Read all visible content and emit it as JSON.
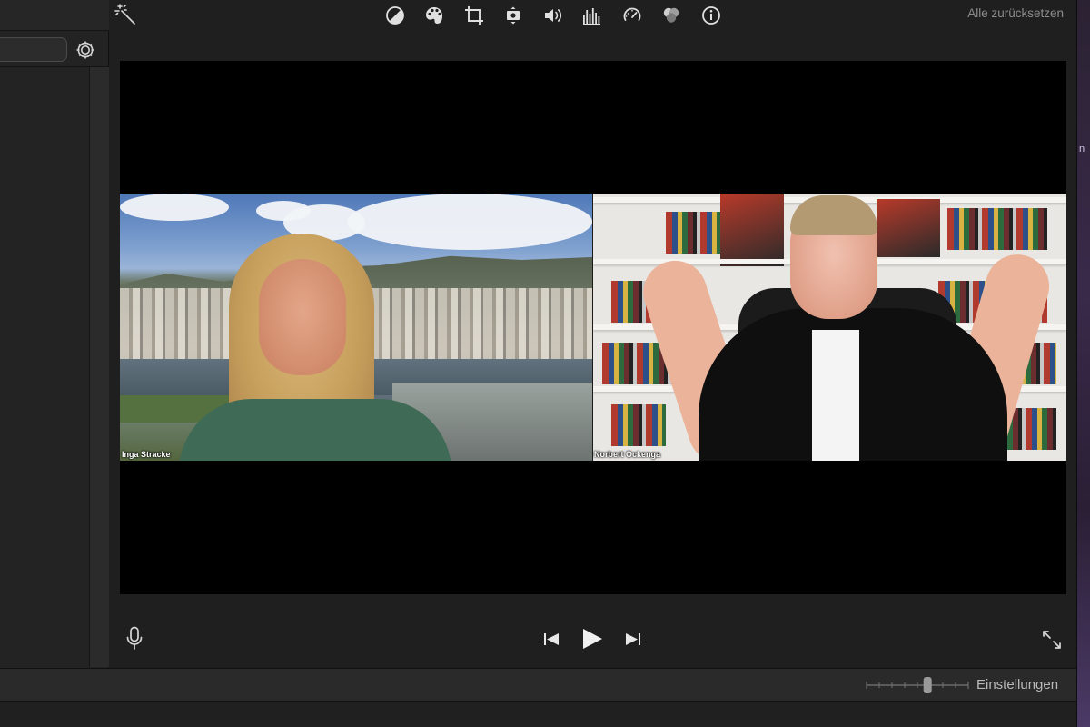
{
  "browser": {
    "search_value": ""
  },
  "viewer": {
    "toolbar": {
      "tools": [
        {
          "name": "magic-wand-icon"
        },
        {
          "name": "color-balance-icon"
        },
        {
          "name": "color-correction-icon"
        },
        {
          "name": "crop-icon"
        },
        {
          "name": "stabilization-icon"
        },
        {
          "name": "volume-icon"
        },
        {
          "name": "noise-reduction-equalizer-icon"
        },
        {
          "name": "speed-icon"
        },
        {
          "name": "clip-filter-icon"
        },
        {
          "name": "info-icon"
        }
      ],
      "reset_all_label": "Alle zurücksetzen"
    },
    "video": {
      "participant_left_name": "Inga Stracke",
      "participant_right_name": "Norbert Ockenga"
    },
    "controls": {
      "mic": "microphone-icon",
      "previous": "skip-back-icon",
      "play": "play-icon",
      "next": "skip-forward-icon",
      "fullscreen": "fullscreen-icon"
    }
  },
  "bottom_bar": {
    "zoom_level": 0.6,
    "settings_label": "Einstellungen"
  },
  "right_edge_glyph": "n",
  "colors": {
    "background": "#1e1e1e",
    "panel": "#232323",
    "toolbar_icon": "#d8d8d8",
    "muted_text": "#8c8c8c"
  }
}
